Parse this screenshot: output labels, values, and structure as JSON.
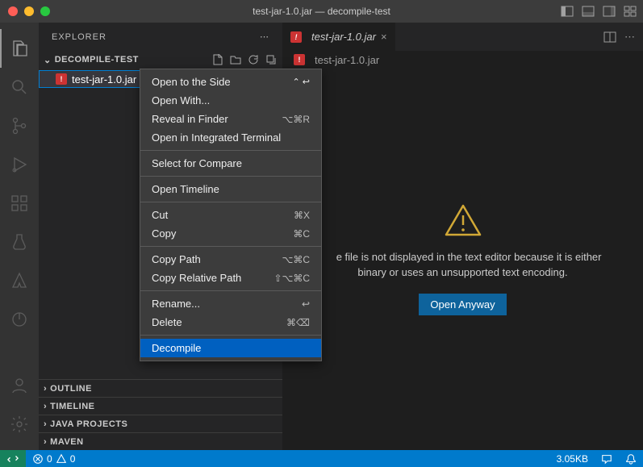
{
  "titlebar": {
    "title": "test-jar-1.0.jar — decompile-test",
    "traffic_colors": {
      "close": "#ff5f57",
      "min": "#febc2e",
      "max": "#28c840"
    }
  },
  "sidebar": {
    "title": "EXPLORER",
    "workspace": "DECOMPILE-TEST",
    "file": "test-jar-1.0.jar",
    "collapsed": [
      "OUTLINE",
      "TIMELINE",
      "JAVA PROJECTS",
      "MAVEN"
    ]
  },
  "tabs": {
    "active": "test-jar-1.0.jar",
    "breadcrumb": "test-jar-1.0.jar"
  },
  "editor": {
    "message": "The file is not displayed in the text editor because it is either binary or uses an unsupported text encoding.",
    "button": "Open Anyway"
  },
  "statusbar": {
    "errors": "0",
    "warnings": "0",
    "size": "3.05KB"
  },
  "context_menu": {
    "groups": [
      [
        {
          "label": "Open to the Side",
          "shortcut": "",
          "submenu_icons": true
        },
        {
          "label": "Open With...",
          "shortcut": ""
        },
        {
          "label": "Reveal in Finder",
          "shortcut": "⌥⌘R"
        },
        {
          "label": "Open in Integrated Terminal",
          "shortcut": ""
        }
      ],
      [
        {
          "label": "Select for Compare",
          "shortcut": ""
        }
      ],
      [
        {
          "label": "Open Timeline",
          "shortcut": ""
        }
      ],
      [
        {
          "label": "Cut",
          "shortcut": "⌘X"
        },
        {
          "label": "Copy",
          "shortcut": "⌘C"
        }
      ],
      [
        {
          "label": "Copy Path",
          "shortcut": "⌥⌘C"
        },
        {
          "label": "Copy Relative Path",
          "shortcut": "⇧⌥⌘C"
        }
      ],
      [
        {
          "label": "Rename...",
          "shortcut": "↩"
        },
        {
          "label": "Delete",
          "shortcut": "⌘⌫"
        }
      ],
      [
        {
          "label": "Decompile",
          "shortcut": "",
          "highlighted": true
        }
      ]
    ]
  }
}
